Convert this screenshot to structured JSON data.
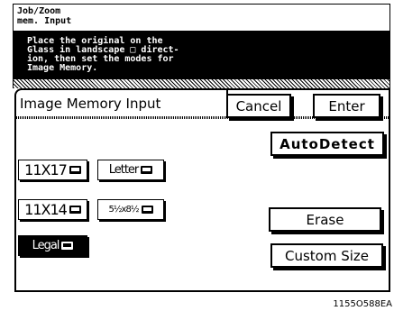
{
  "header": {
    "line1": "Job/Zoom",
    "line2": "mem. Input"
  },
  "message": {
    "line1": "Place the original on the",
    "line2": "Glass in landscape □ direct-",
    "line3": "ion, then set the modes for",
    "line4": "Image Memory."
  },
  "panel": {
    "title": "Image Memory Input"
  },
  "buttons": {
    "cancel": "Cancel",
    "enter": "Enter",
    "autodetect": "AutoDetect",
    "erase": "Erase",
    "custom_size": "Custom Size"
  },
  "paper_sizes": [
    {
      "label": "11X17",
      "selected": false
    },
    {
      "label": "Letter",
      "selected": false
    },
    {
      "label": "11X14",
      "selected": false
    },
    {
      "label": "5½x8½",
      "selected": false
    },
    {
      "label": "Legal",
      "selected": true
    }
  ],
  "figure_id": "1155O588EA"
}
